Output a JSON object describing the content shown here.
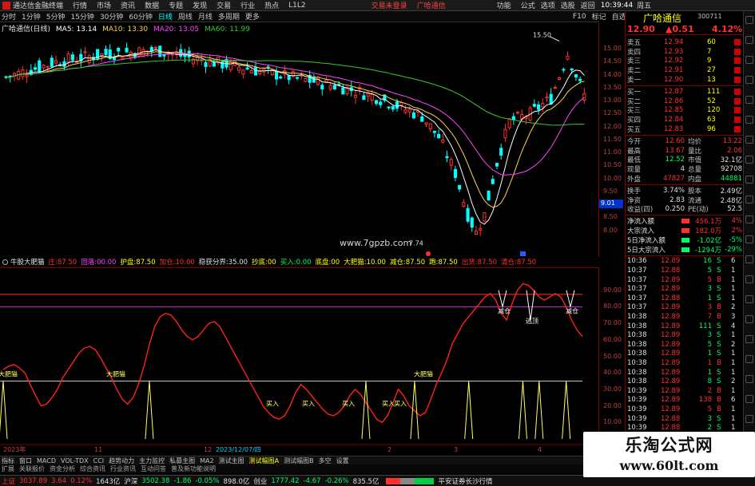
{
  "menu": {
    "app_title": "通达信金融终端",
    "items": [
      "行情",
      "市场",
      "资讯",
      "数据",
      "专题",
      "发现",
      "交易",
      "行业",
      "热点",
      "L1L2"
    ],
    "trade_warn": "交易未登录",
    "stock_name_tag": "广哈通信",
    "right_items": [
      "功能",
      "公式",
      "选项",
      "选股",
      "返回"
    ],
    "time": "10:39:44",
    "weekday": "周五"
  },
  "periods": {
    "items": [
      "分时",
      "1分钟",
      "5分钟",
      "15分钟",
      "30分钟",
      "60分钟",
      "日线",
      "周线",
      "月线",
      "多周期",
      "更多"
    ],
    "active": "日线",
    "right_items": [
      "F10",
      "标记",
      "自选"
    ]
  },
  "ma_header": {
    "label": "广哈通信(日线)",
    "ma5": "MA5: 13.14",
    "ma10": "MA10: 13.30",
    "ma20": "MA20: 13.05",
    "ma60": "MA60: 11.99"
  },
  "chart_data": [
    {
      "type": "candlestick",
      "title": "广哈通信(日线)",
      "high_label": "15.50",
      "low_label": "7.74",
      "watermark": "www.7gpzb.com",
      "yaxis": {
        "ylim": [
          7.74,
          15.5
        ],
        "ticks": [
          "15.00",
          "14.50",
          "14.00",
          "13.50",
          "13.00",
          "12.50",
          "12.00",
          "11.50",
          "11.00",
          "10.50",
          "10.00",
          "9.50",
          "9.00",
          "8.50",
          "8.00"
        ],
        "marker": "9.01"
      },
      "ma": [
        "MA5",
        "MA10",
        "MA20",
        "MA60"
      ]
    },
    {
      "type": "line",
      "title": "牛股大肥猫",
      "header_items": [
        "牛股大肥猫",
        "庄:87.50",
        "回落:00.00",
        "护盘:87.50",
        "加仓:10.00",
        "稳获分界:35.00",
        "抄底:00",
        "买入:0.00",
        "底盘:00",
        "大肥猫:10.00",
        "减仓:87.50",
        "跑:87.50",
        "出货:87.50",
        "清仓:87.50"
      ],
      "yaxis": {
        "ylim": [
          0,
          100
        ],
        "ticks": [
          "90.00",
          "80.00",
          "70.00",
          "60.00",
          "50.00",
          "40.00",
          "30.00",
          "20.00",
          "10.00"
        ]
      },
      "hlines": [
        {
          "y": 87.5,
          "color": "#ff3030"
        },
        {
          "y": 80,
          "color": "#cc33cc"
        },
        {
          "y": 35,
          "color": "#c8c8c8"
        }
      ],
      "series": [
        {
          "values": [
            42,
            44,
            45,
            43,
            40,
            33,
            26,
            20,
            21,
            25,
            30,
            37,
            42,
            47,
            52,
            55,
            56,
            54,
            49,
            43,
            37,
            30,
            24,
            21,
            25,
            33,
            44,
            57,
            68,
            74,
            76,
            75,
            71,
            66,
            62,
            60,
            62,
            66,
            70,
            71,
            68,
            62,
            56,
            50,
            44,
            38,
            32,
            26,
            20,
            16,
            13,
            12,
            14,
            20,
            28,
            33,
            30,
            26,
            22,
            18,
            15,
            14,
            16,
            20,
            26,
            30,
            27,
            22,
            17,
            12,
            10,
            14,
            22,
            30,
            26,
            20,
            17,
            14,
            16,
            24,
            33,
            40,
            48,
            58,
            64,
            70,
            74,
            78,
            82,
            86,
            88,
            84,
            76,
            72,
            82,
            90,
            94,
            93,
            90,
            86,
            84,
            86,
            88,
            86,
            80,
            72,
            66,
            62
          ]
        }
      ],
      "annotations": [
        {
          "text": "大肥猫",
          "at": 0
        },
        {
          "text": "大肥猫",
          "at": 27
        },
        {
          "text": "买入",
          "at": 67
        },
        {
          "text": "买入",
          "at": 76
        },
        {
          "text": "买入",
          "at": 86
        },
        {
          "text": "买入",
          "at": 96
        },
        {
          "text": "买入",
          "at": 99
        },
        {
          "text": "大肥猫",
          "at": 104
        },
        {
          "text": "减仓",
          "at": 125
        },
        {
          "text": "逃顶",
          "at": 132
        },
        {
          "text": "减仓",
          "at": 142
        }
      ],
      "xaxis": {
        "labels": [
          "2023年",
          "11",
          "12",
          "2023/12/07/四",
          "2",
          "3",
          "4"
        ]
      }
    }
  ],
  "tabs": [
    "指标",
    "窗口",
    "MACD",
    "VOL-TDX",
    "CCI",
    "趋势动力",
    "主力监控",
    "私募主图",
    "MA2",
    "测试主图",
    "测试幅图A",
    "测试幅图B",
    "多空",
    "设置"
  ],
  "tabs_active": "测试幅图A",
  "tabs2": [
    "扩展",
    "关联报价",
    "资金分析",
    "综合资讯",
    "行业资讯",
    "互动问答",
    "普及新功能说明"
  ],
  "status": {
    "sh_label": "上证",
    "sh_val": "3037.89",
    "sh_chg": "3.64",
    "sh_pct": "0.12%",
    "sh_amt": "1643亿",
    "sz_label": "沪深",
    "sz_val": "3502.38",
    "sz_chg": "-1.86",
    "sz_pct": "-0.05%",
    "sz_amt": "898.0亿",
    "cy_label": "创业",
    "cy_val": "1777.42",
    "cy_chg": "-4.67",
    "cy_pct": "-0.26%",
    "cy_amt": "835.5亿",
    "broker": "平安证券长沙行情"
  },
  "quote": {
    "name": "广哈通信",
    "code": "300711",
    "price": "12.90",
    "change": "▲0.51",
    "pct": "4.12%",
    "sells": [
      {
        "label": "卖五",
        "price": "12.94",
        "vol": "60"
      },
      {
        "label": "卖四",
        "price": "12.93",
        "vol": "7"
      },
      {
        "label": "卖三",
        "price": "12.92",
        "vol": "9"
      },
      {
        "label": "卖二",
        "price": "12.91",
        "vol": "27"
      },
      {
        "label": "卖一",
        "price": "12.90",
        "vol": "13"
      }
    ],
    "buys": [
      {
        "label": "买一",
        "price": "12.87",
        "vol": "111"
      },
      {
        "label": "买二",
        "price": "12.86",
        "vol": "52"
      },
      {
        "label": "买三",
        "price": "12.85",
        "vol": "120"
      },
      {
        "label": "买四",
        "price": "12.84",
        "vol": "63"
      },
      {
        "label": "买五",
        "price": "12.83",
        "vol": "96"
      }
    ],
    "stats": [
      {
        "l1": "今开",
        "v1": "12.60",
        "l2": "均价",
        "v2": "13.22"
      },
      {
        "l1": "最高",
        "v1": "13.67",
        "l2": "量比",
        "v2": "2.06"
      },
      {
        "l1": "最低",
        "v1": "12.52",
        "l2": "市值",
        "v2": "32.1亿"
      },
      {
        "l1": "现量",
        "v1": "4",
        "l2": "总量",
        "v2": "92708"
      },
      {
        "l1": "外盘",
        "v1": "47827",
        "l2": "内盘",
        "v2": "44881"
      },
      {
        "l1": "换手",
        "v1": "3.74%",
        "l2": "股本",
        "v2": "2.49亿"
      },
      {
        "l1": "净资",
        "v1": "2.83",
        "l2": "流通",
        "v2": "2.48亿"
      },
      {
        "l1": "收益(四)",
        "v1": "0.250",
        "l2": "PE(动)",
        "v2": "52.5"
      }
    ],
    "flows": [
      {
        "label": "净流入额",
        "val": "456.1万",
        "pct": "4%"
      },
      {
        "label": "大宗流入",
        "val": "182.0万",
        "pct": "2%"
      },
      {
        "label": "5日净流入额",
        "val": "-1.02亿",
        "pct": "-5%"
      },
      {
        "label": "5日大宗流入",
        "val": "-1294万",
        "pct": "-29%"
      }
    ],
    "ticks": [
      {
        "t": "10:36",
        "p": "12.89",
        "v": "16",
        "d": "S",
        "n": "6"
      },
      {
        "t": "10:37",
        "p": "12.88",
        "v": "5",
        "d": "S",
        "n": "1"
      },
      {
        "t": "10:37",
        "p": "12.89",
        "v": "5",
        "d": "B",
        "n": "1"
      },
      {
        "t": "10:37",
        "p": "12.89",
        "v": "3",
        "d": "S",
        "n": "1"
      },
      {
        "t": "10:37",
        "p": "12.88",
        "v": "1",
        "d": "S",
        "n": "1"
      },
      {
        "t": "10:37",
        "p": "12.89",
        "v": "3",
        "d": "B",
        "n": "2"
      },
      {
        "t": "10:38",
        "p": "12.89",
        "v": "7",
        "d": "B",
        "n": "3"
      },
      {
        "t": "10:38",
        "p": "12.89",
        "v": "111",
        "d": "S",
        "n": "4"
      },
      {
        "t": "10:38",
        "p": "12.89",
        "v": "3",
        "d": "S",
        "n": "1"
      },
      {
        "t": "10:38",
        "p": "12.89",
        "v": "5",
        "d": "S",
        "n": "2"
      },
      {
        "t": "10:38",
        "p": "12.89",
        "v": "1",
        "d": "S",
        "n": "1"
      },
      {
        "t": "10:38",
        "p": "12.89",
        "v": "1",
        "d": "B",
        "n": "1"
      },
      {
        "t": "10:38",
        "p": "12.89",
        "v": "1",
        "d": "S",
        "n": "1"
      },
      {
        "t": "10:38",
        "p": "12.89",
        "v": "8",
        "d": "S",
        "n": "2"
      },
      {
        "t": "10:39",
        "p": "12.89",
        "v": "2",
        "d": "B",
        "n": "1"
      },
      {
        "t": "10:39",
        "p": "12.89",
        "v": "138",
        "d": "B",
        "n": "6"
      },
      {
        "t": "10:39",
        "p": "12.89",
        "v": "5",
        "d": "B",
        "n": "1"
      },
      {
        "t": "10:39",
        "p": "12.88",
        "v": "3",
        "d": "S",
        "n": "1"
      },
      {
        "t": "10:39",
        "p": "12.88",
        "v": "2",
        "d": "S",
        "n": "1"
      },
      {
        "t": "10:39",
        "p": "12.89",
        "v": "1",
        "d": "B",
        "n": "1"
      },
      {
        "t": "10:39",
        "p": "12.89",
        "v": "5",
        "d": "B",
        "n": "1"
      },
      {
        "t": "10:39",
        "p": "12.89",
        "v": "1",
        "d": "B",
        "n": "1"
      }
    ]
  },
  "watermark": {
    "line1": "乐淘公式网",
    "line2": "www.60lt.com"
  },
  "colors": {
    "up": "#ff3030",
    "down": "#00ffff",
    "ma5": "#ffffff",
    "ma10": "#ffd24a",
    "ma20": "#ff44ff",
    "ma60": "#33cc33",
    "frame": "#800000"
  }
}
